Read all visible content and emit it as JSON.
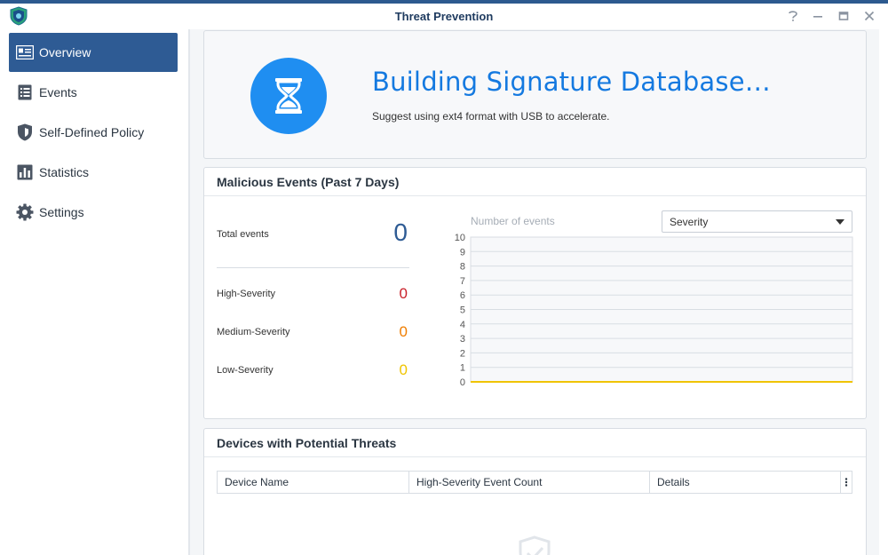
{
  "window": {
    "title": "Threat Prevention"
  },
  "sidebar": {
    "items": [
      {
        "label": "Overview",
        "icon": "overview-icon",
        "active": true
      },
      {
        "label": "Events",
        "icon": "events-list-icon"
      },
      {
        "label": "Self-Defined Policy",
        "icon": "shield-icon"
      },
      {
        "label": "Statistics",
        "icon": "statistics-icon"
      },
      {
        "label": "Settings",
        "icon": "gear-icon"
      }
    ]
  },
  "status": {
    "title": "Building Signature Database…",
    "subtitle": "Suggest using ext4 format with USB to accelerate."
  },
  "malicious": {
    "header": "Malicious Events (Past 7 Days)",
    "total_label": "Total events",
    "total_value": "0",
    "high_label": "High-Severity",
    "high_value": "0",
    "medium_label": "Medium-Severity",
    "medium_value": "0",
    "low_label": "Low-Severity",
    "low_value": "0",
    "colors": {
      "high": "#c9202a",
      "medium": "#ef7d00",
      "low": "#f0c400"
    }
  },
  "chart_data": {
    "type": "line",
    "ylabel": "Number of events",
    "ylim": [
      0,
      10
    ],
    "yticks": [
      0,
      1,
      2,
      3,
      4,
      5,
      6,
      7,
      8,
      9,
      10
    ],
    "series": [
      {
        "values": [
          0,
          0
        ]
      }
    ],
    "line_color": "#f0c400",
    "grid": true
  },
  "filter": {
    "selected": "Severity"
  },
  "devices": {
    "header": "Devices with Potential Threats",
    "columns": [
      "Device Name",
      "High-Severity Event Count",
      "Details"
    ]
  }
}
